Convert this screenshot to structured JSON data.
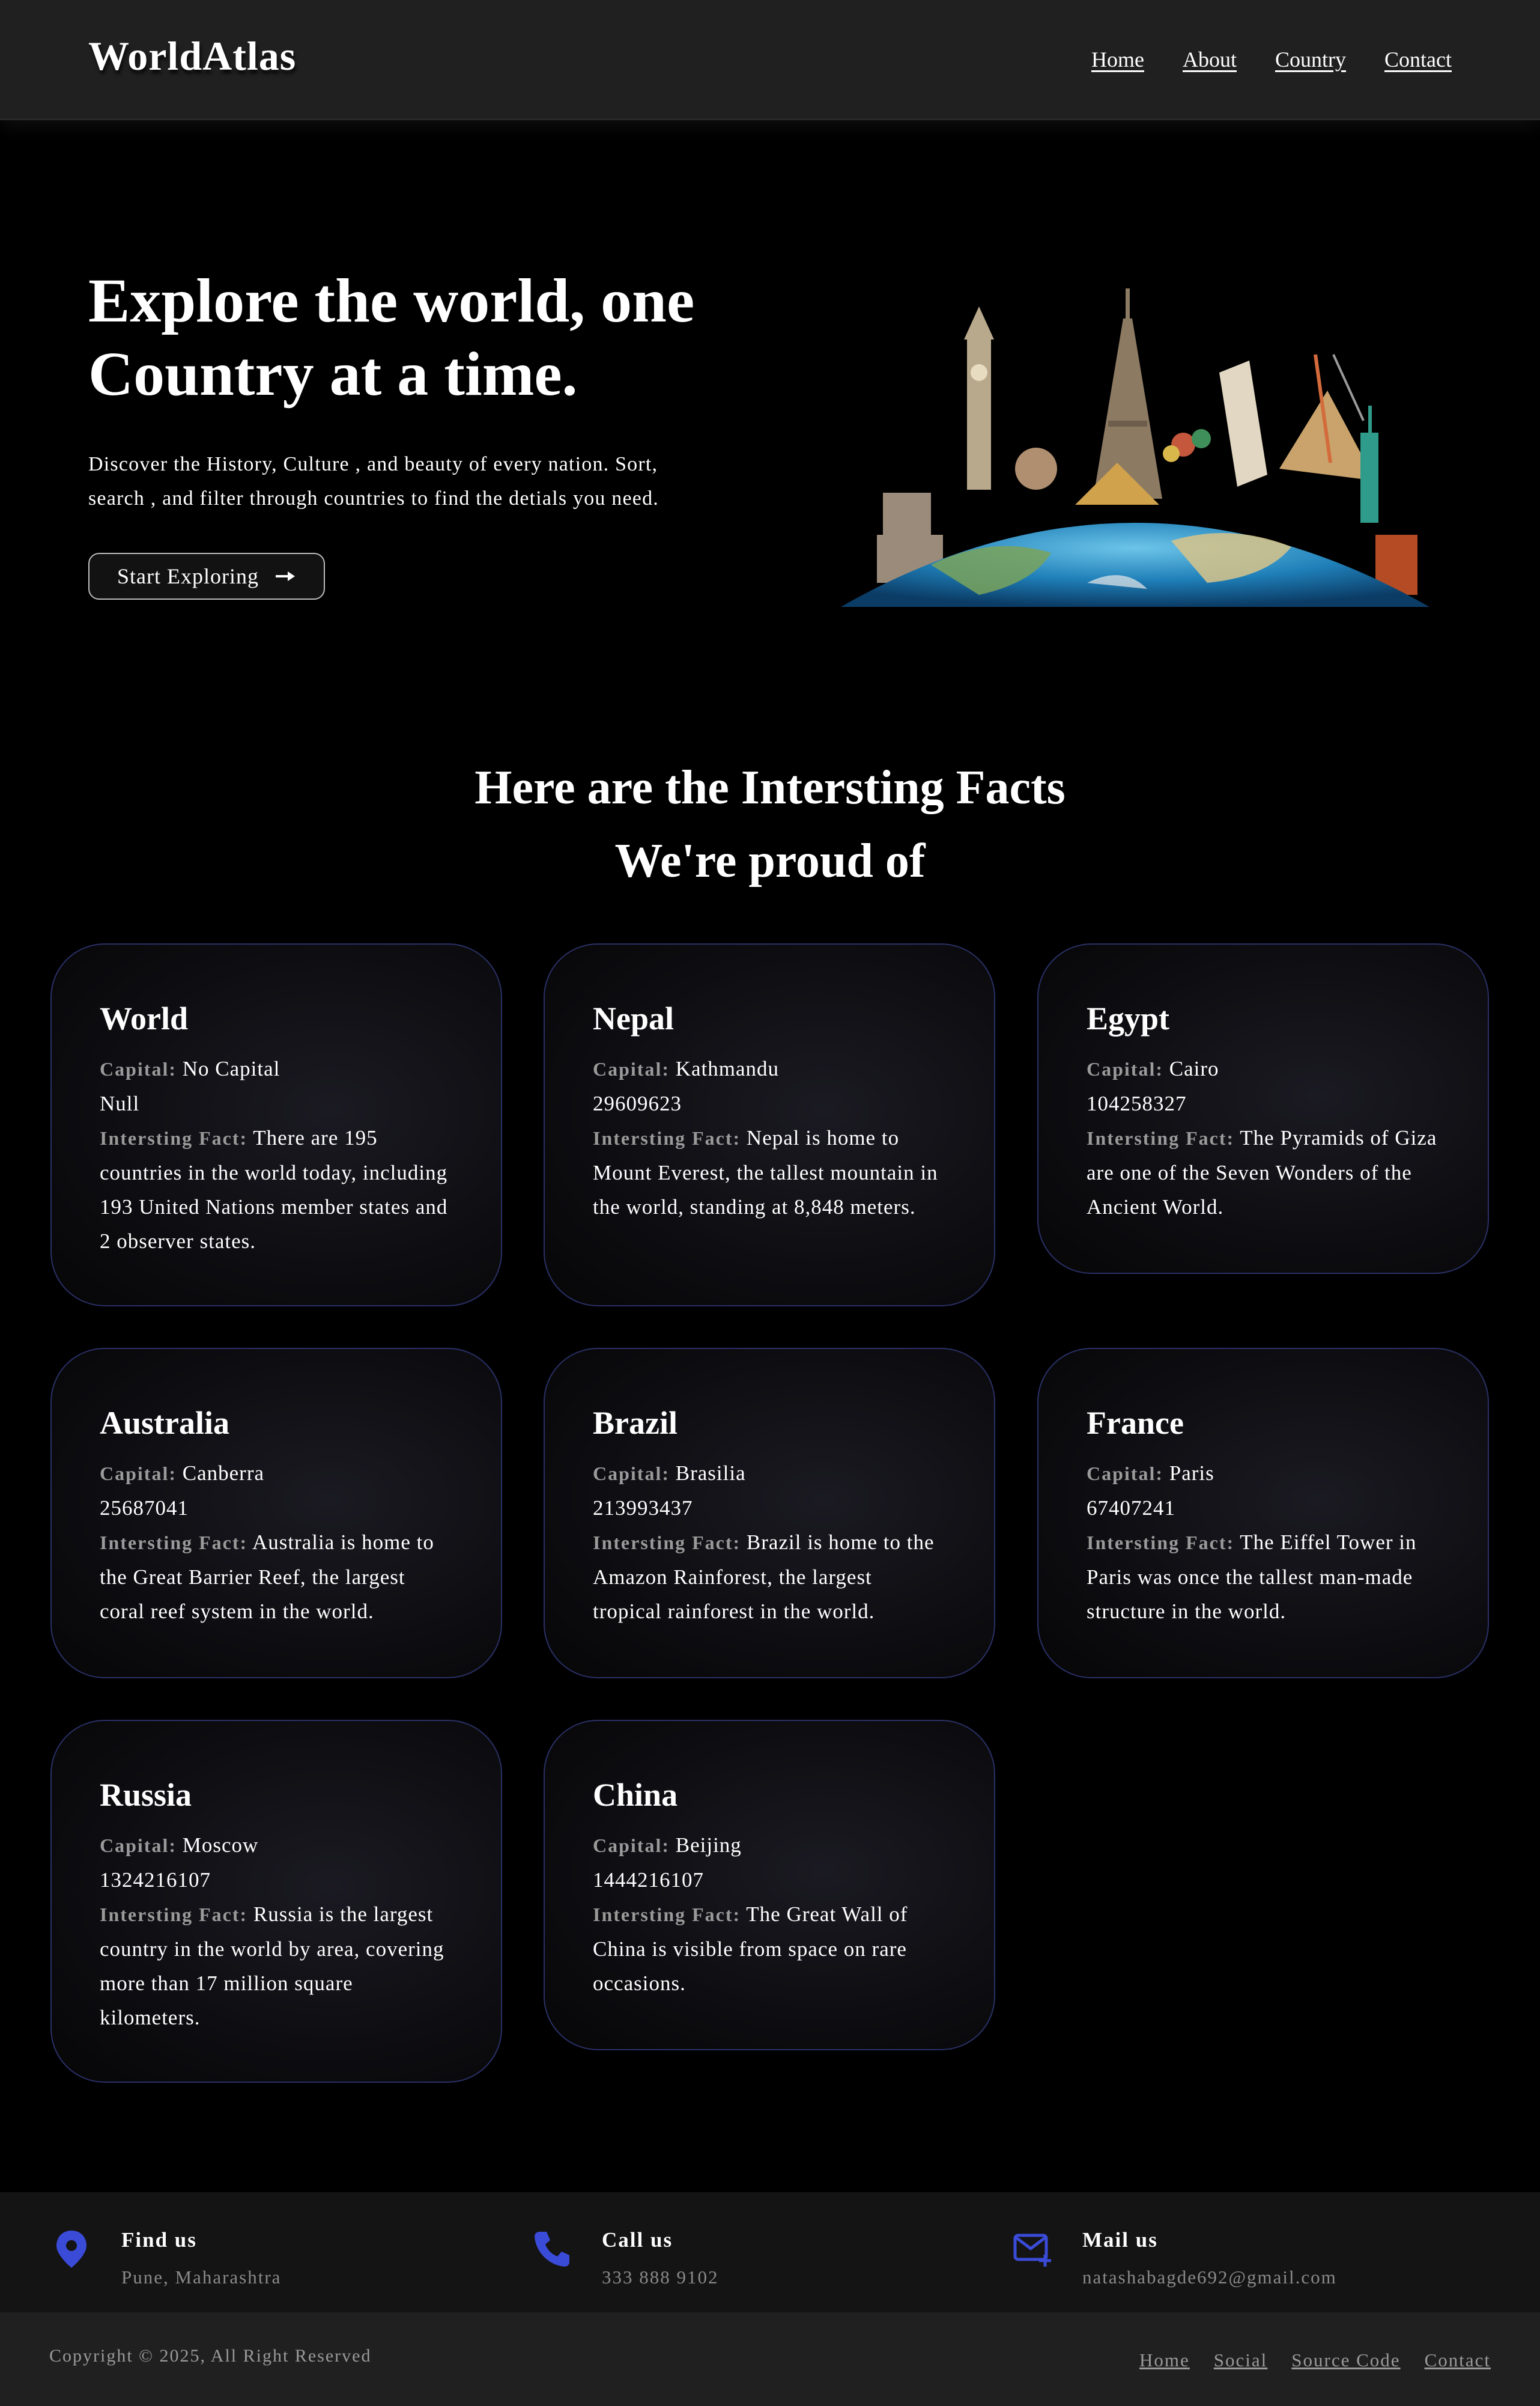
{
  "header": {
    "logo": "WorldAtlas",
    "nav": [
      "Home",
      "About",
      "Country",
      "Contact"
    ]
  },
  "hero": {
    "title": "Explore the world, one Country at a time.",
    "description": "Discover the History, Culture , and beauty of every nation. Sort, search , and filter through countries to find the detials you need.",
    "button_label": "Start Exploring",
    "button_icon": "arrow-right-icon",
    "image_icon": "world-landmarks-globe"
  },
  "facts": {
    "title_line1": "Here are the Intersting Facts",
    "title_line2": "We're proud of",
    "capital_label": "Capital:",
    "fact_label": "Intersting Fact:",
    "cards": [
      {
        "name": "World",
        "capital": "No Capital",
        "population": "Null",
        "fact": "There are 195 countries in the world today, including 193 United Nations member states and 2 observer states."
      },
      {
        "name": "Nepal",
        "capital": "Kathmandu",
        "population": "29609623",
        "fact": "Nepal is home to Mount Everest, the tallest mountain in the world, standing at 8,848 meters."
      },
      {
        "name": "Egypt",
        "capital": "Cairo",
        "population": "104258327",
        "fact": "The Pyramids of Giza are one of the Seven Wonders of the Ancient World."
      },
      {
        "name": "Australia",
        "capital": "Canberra",
        "population": "25687041",
        "fact": "Australia is home to the Great Barrier Reef, the largest coral reef system in the world."
      },
      {
        "name": "Brazil",
        "capital": "Brasilia",
        "population": "213993437",
        "fact": "Brazil is home to the Amazon Rainforest, the largest tropical rainforest in the world."
      },
      {
        "name": "France",
        "capital": "Paris",
        "population": "67407241",
        "fact": "The Eiffel Tower in Paris was once the tallest man-made structure in the world."
      },
      {
        "name": "Russia",
        "capital": "Moscow",
        "population": "1324216107",
        "fact": "Russia is the largest country in the world by area, covering more than 17 million square kilometers."
      },
      {
        "name": "China",
        "capital": "Beijing",
        "population": "1444216107",
        "fact": "The Great Wall of China is visible from space on rare occasions."
      }
    ]
  },
  "footer": {
    "contacts": [
      {
        "title": "Find us",
        "value": "Pune, Maharashtra",
        "icon": "location-pin-icon"
      },
      {
        "title": "Call us",
        "value": "333 888 9102",
        "icon": "phone-icon"
      },
      {
        "title": "Mail us",
        "value": "natashabagde692@gmail.com",
        "icon": "mail-add-icon"
      }
    ],
    "copyright": "Copyright © 2025, All Right Reserved",
    "links": [
      "Home",
      "Social",
      "Source Code",
      "Contact"
    ],
    "accent_color": "#3a4bd8"
  }
}
